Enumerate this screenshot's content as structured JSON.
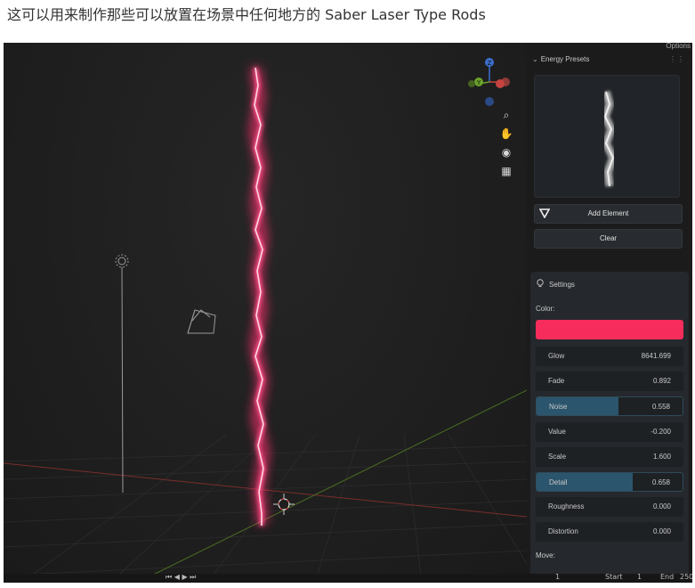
{
  "caption": "这可以用来制作那些可以放置在场景中任何地方的 Saber Laser Type Rods",
  "colors": {
    "saber_core": "#ffd6e6",
    "saber_glow": "#ff2f6e",
    "accent_color": "#f62c5c",
    "slider_fill": "#2b556c",
    "axis_x": "#c5443f",
    "axis_y": "#6aa22a",
    "axis_z": "#3b6fce"
  },
  "viewport": {
    "gizmo": {
      "z_label": "Z",
      "y_label": "Y"
    }
  },
  "sidebar": {
    "options_label": "Options",
    "panel_title": "Energy Presets",
    "add_element_label": "Add Element",
    "clear_label": "Clear"
  },
  "settings": {
    "title": "Settings",
    "color_label": "Color:",
    "move_label": "Move:",
    "properties": [
      {
        "label": "Glow",
        "value": "8641.699",
        "fill": 0
      },
      {
        "label": "Fade",
        "value": "0.892",
        "fill": 0
      },
      {
        "label": "Noise",
        "value": "0.558",
        "fill": 0.558
      },
      {
        "label": "Value",
        "value": "-0.200",
        "fill": 0
      },
      {
        "label": "Scale",
        "value": "1.600",
        "fill": 0
      },
      {
        "label": "Detail",
        "value": "0.658",
        "fill": 0.658
      },
      {
        "label": "Roughness",
        "value": "0.000",
        "fill": 0
      },
      {
        "label": "Distortion",
        "value": "0.000",
        "fill": 0
      }
    ]
  },
  "footer": {
    "frame_value": "1",
    "start_label": "Start",
    "start_value": "1",
    "end_label": "End",
    "end_value": "250"
  }
}
